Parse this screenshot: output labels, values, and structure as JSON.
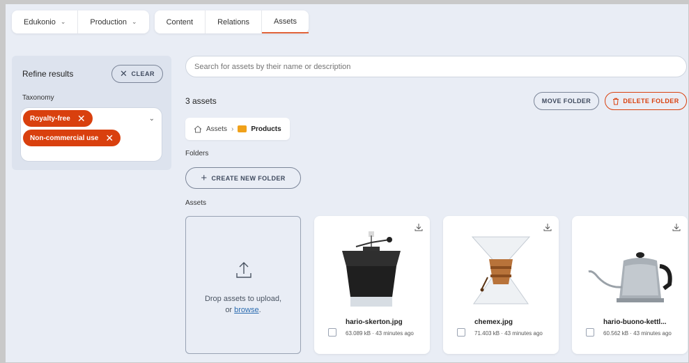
{
  "nav": {
    "org": "Edukonio",
    "env": "Production",
    "tabs": [
      "Content",
      "Relations",
      "Assets"
    ],
    "active_tab": "Assets"
  },
  "refine": {
    "title": "Refine results",
    "clear_label": "CLEAR",
    "taxonomy_label": "Taxonomy",
    "tags": [
      "Royalty-free",
      "Non-commercial use"
    ]
  },
  "search": {
    "placeholder": "Search for assets by their name or description"
  },
  "assets_count": "3 assets",
  "actions": {
    "move": "MOVE FOLDER",
    "delete": "DELETE FOLDER"
  },
  "breadcrumb": {
    "root": "Assets",
    "current": "Products"
  },
  "folders_label": "Folders",
  "new_folder_label": "CREATE NEW FOLDER",
  "assets_label": "Assets",
  "dropzone": {
    "text": "Drop assets to upload,",
    "or": "or",
    "browse": "browse",
    "period": "."
  },
  "cards": [
    {
      "name": "hario-skerton.jpg",
      "meta": "63.089 kB · 43 minutes ago",
      "icon": "coffee-grinder"
    },
    {
      "name": "chemex.jpg",
      "meta": "71.403 kB · 43 minutes ago",
      "icon": "chemex-coffee-maker"
    },
    {
      "name": "hario-buono-kettl...",
      "meta": "60.562 kB · 43 minutes ago",
      "icon": "gooseneck-kettle"
    }
  ],
  "colors": {
    "accent": "#d9400e",
    "background": "#e9edf5",
    "folder": "#f0a11a"
  }
}
